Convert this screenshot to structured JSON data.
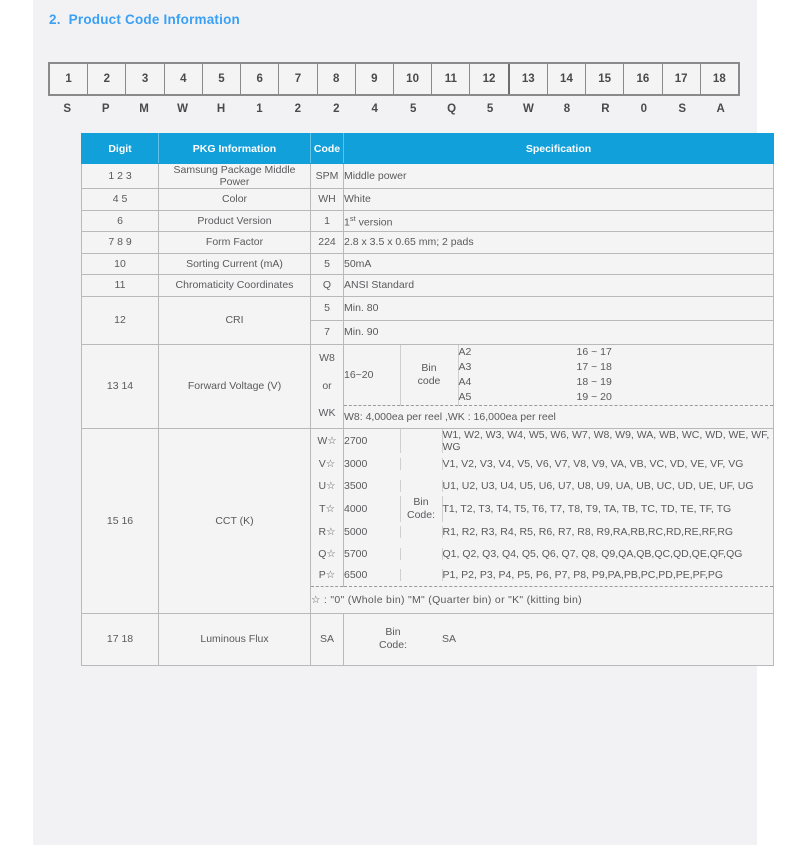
{
  "section": {
    "number": "2.",
    "title": "Product Code Information"
  },
  "digit_strip": {
    "digits": [
      "1",
      "2",
      "3",
      "4",
      "5",
      "6",
      "7",
      "8",
      "9",
      "10",
      "11",
      "12",
      "13",
      "14",
      "15",
      "16",
      "17",
      "18"
    ],
    "values": [
      "S",
      "P",
      "M",
      "W",
      "H",
      "1",
      "2",
      "2",
      "4",
      "5",
      "Q",
      "5",
      "W",
      "8",
      "R",
      "0",
      "S",
      "A"
    ],
    "thick_divider_before_index": 12
  },
  "table": {
    "headers": {
      "digit": "Digit",
      "pkg": "PKG Information",
      "code": "Code",
      "spec": "Specification"
    },
    "rows": [
      {
        "digit": "1  2  3",
        "pkg": "Samsung Package Middle Power",
        "code": "SPM",
        "spec": "Middle power"
      },
      {
        "digit": "4  5",
        "pkg": "Color",
        "code": "WH",
        "spec": "White"
      },
      {
        "digit": "6",
        "pkg": "Product Version",
        "code": "1",
        "spec_pre": "1",
        "spec_sup": "st",
        "spec_post": " version"
      },
      {
        "digit": "7  8  9",
        "pkg": "Form Factor",
        "code": "224",
        "spec": "2.8 x 3.5 x 0.65 mm;   2 pads"
      },
      {
        "digit": "10",
        "pkg": "Sorting Current (mA)",
        "code": "5",
        "spec": "50mA"
      },
      {
        "digit": "11",
        "pkg": "Chromaticity Coordinates",
        "code": "Q",
        "spec": "ANSI Standard"
      }
    ],
    "cri": {
      "digit": "12",
      "pkg": "CRI",
      "items": [
        {
          "code": "5",
          "spec": "Min. 80"
        },
        {
          "code": "7",
          "spec": "Min. 90"
        }
      ]
    },
    "forward_voltage": {
      "digit": "13  14",
      "pkg": "Forward Voltage (V)",
      "code_lines": [
        "W8",
        "or",
        "WK"
      ],
      "range": "16~20",
      "bin_label_line1": "Bin",
      "bin_label_line2": "code",
      "bins": [
        {
          "code": "A2",
          "range": "16 ~ 17"
        },
        {
          "code": "A3",
          "range": "17 ~ 18"
        },
        {
          "code": "A4",
          "range": "18 ~ 19"
        },
        {
          "code": "A5",
          "range": "19 ~ 20"
        }
      ],
      "note": "W8: 4,000ea per reel ,WK : 16,000ea per reel"
    },
    "cct": {
      "digit": "15  16",
      "pkg": "CCT (K)",
      "bin_label_line1": "Bin",
      "bin_label_line2": "Code:",
      "rows": [
        {
          "code": "W☆",
          "temp": "2700",
          "bins": "W1, W2, W3, W4, W5, W6, W7, W8, W9, WA, WB, WC, WD, WE, WF, WG"
        },
        {
          "code": "V☆",
          "temp": "3000",
          "bins": "V1, V2, V3, V4, V5, V6, V7, V8, V9, VA, VB, VC, VD, VE, VF, VG"
        },
        {
          "code": "U☆",
          "temp": "3500",
          "bins": "U1, U2, U3, U4, U5, U6, U7, U8, U9, UA, UB, UC, UD, UE, UF, UG"
        },
        {
          "code": "T☆",
          "temp": "4000",
          "bins": "T1, T2, T3, T4, T5, T6, T7, T8, T9, TA, TB, TC, TD, TE, TF, TG"
        },
        {
          "code": "R☆",
          "temp": "5000",
          "bins": "R1, R2, R3, R4, R5, R6, R7, R8, R9,RA,RB,RC,RD,RE,RF,RG"
        },
        {
          "code": "Q☆",
          "temp": "5700",
          "bins": "Q1, Q2, Q3, Q4, Q5, Q6, Q7, Q8, Q9,QA,QB,QC,QD,QE,QF,QG"
        },
        {
          "code": "P☆",
          "temp": "6500",
          "bins": "P1, P2, P3, P4, P5, P6, P7, P8, P9,PA,PB,PC,PD,PE,PF,PG"
        }
      ],
      "star_note": "☆ :   \"0\" (Whole bin)    \"M\" (Quarter bin) or    \"K\" (kitting bin)"
    },
    "luminous_flux": {
      "digit": "17  18",
      "pkg": "Luminous Flux",
      "code": "SA",
      "bin_label_line1": "Bin",
      "bin_label_line2": "Code:",
      "value": "SA"
    }
  },
  "colors": {
    "header_blue": "#12a0da",
    "title_blue": "#3aa0f5",
    "page_bg": "#f2f2f4",
    "cell_bg": "#f4f4f5",
    "border": "#b9b9bb",
    "text": "#5a5a5c"
  }
}
